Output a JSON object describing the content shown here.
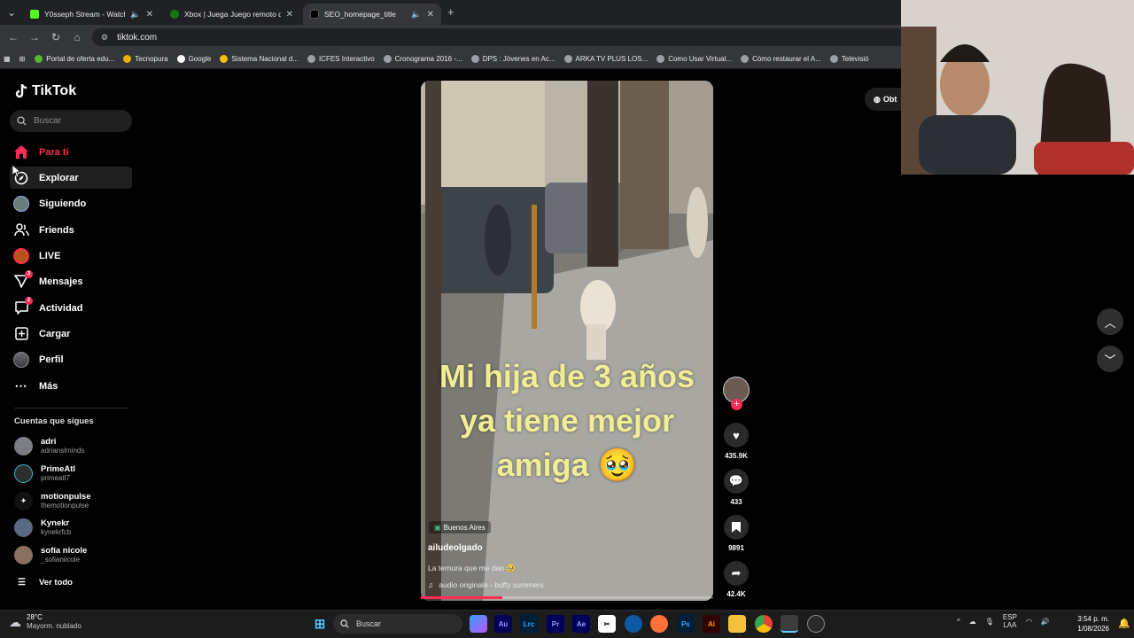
{
  "browser": {
    "tabs": [
      {
        "title": "Y0sseph Stream - Watch Liv",
        "color": "#53fc18"
      },
      {
        "title": "Xbox | Juega Juego remoto de",
        "color": "#107c10"
      },
      {
        "title": "SEO_homepage_title",
        "color": "#000000"
      }
    ],
    "new_tab": "+",
    "url": "tiktok.com",
    "bookmarks": [
      "Portal de oferta edu...",
      "Tecnopura",
      "Google",
      "Sistema Nacional d...",
      "ICFES Interactivo",
      "Cronograma 2016 -...",
      "DPS : Jóvenes en Ac...",
      "ARKA TV PLUS LOS...",
      "Como Usar Virtual...",
      "Cómo restaurar el A...",
      "Televisió"
    ]
  },
  "sidebar": {
    "logo": "TikTok",
    "search_placeholder": "Buscar",
    "nav": [
      {
        "label": "Para ti",
        "icon": "home-icon",
        "active": true
      },
      {
        "label": "Explorar",
        "icon": "compass-icon"
      },
      {
        "label": "Siguiendo",
        "icon": "following-avatar-icon"
      },
      {
        "label": "Friends",
        "icon": "friends-icon"
      },
      {
        "label": "LIVE",
        "icon": "live-icon"
      },
      {
        "label": "Mensajes",
        "icon": "messages-icon",
        "badge": "3"
      },
      {
        "label": "Actividad",
        "icon": "activity-icon",
        "badge": "2"
      },
      {
        "label": "Cargar",
        "icon": "upload-icon"
      },
      {
        "label": "Perfil",
        "icon": "profile-icon"
      },
      {
        "label": "Más",
        "icon": "more-icon"
      }
    ],
    "following_heading": "Cuentas que sigues",
    "accounts": [
      {
        "name": "adri",
        "handle": "adrianslminds"
      },
      {
        "name": "PrimeAtl",
        "handle": "primeatl7"
      },
      {
        "name": "motionpulse",
        "handle": "themotionpulse"
      },
      {
        "name": "Kynekr",
        "handle": "kynekrfcb"
      },
      {
        "name": "sofía nicole",
        "handle": "_sofianiicole"
      }
    ],
    "see_all": "Ver todo"
  },
  "video": {
    "caption": "Mi hija de 3 años ya tiene mejor amiga 🥹",
    "location": "Buenos Aires",
    "author": "ailudeolgado",
    "description": "La ternura que me dan 🥹",
    "audio": "audio originale - buffy summers",
    "progress": 0.28
  },
  "actions": {
    "likes": "435.9K",
    "comments": "433",
    "saves": "9891",
    "shares": "42.4K"
  },
  "get_app": "Obt",
  "taskbar": {
    "weather_temp": "28°C",
    "weather_desc": "Mayorm. nublado",
    "search": "Buscar",
    "lang_line1": "ESP",
    "lang_line2": "LAA",
    "time": "3:54 p. m.",
    "date": "1/08/2026"
  },
  "colors": {
    "accent": "#fe2c55",
    "caption": "#f0ee95"
  }
}
